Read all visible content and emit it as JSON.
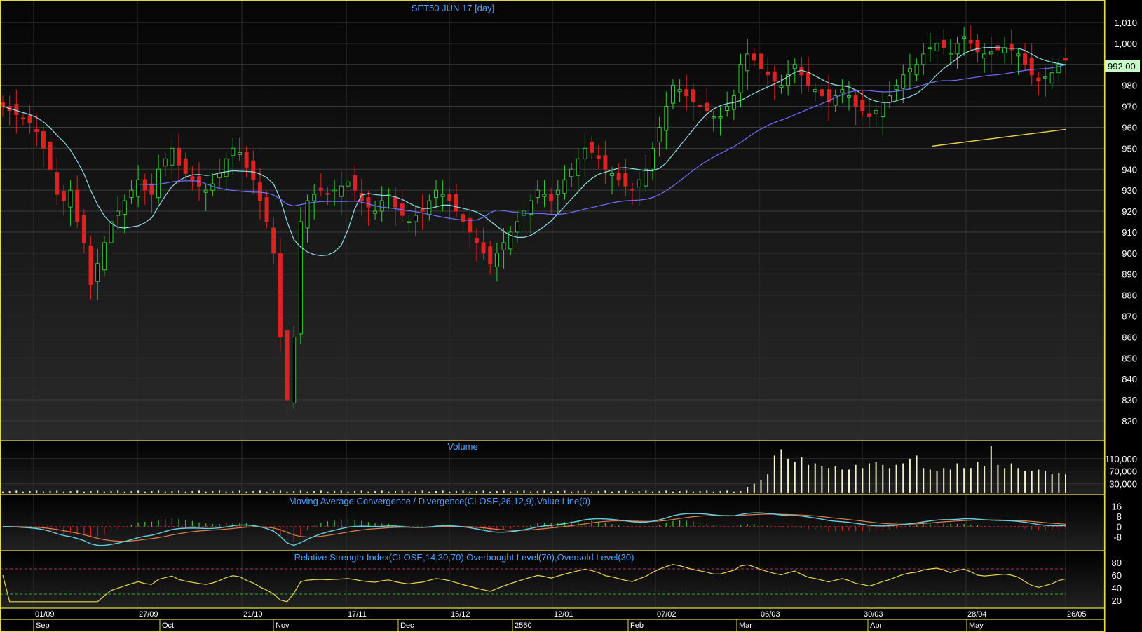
{
  "window": {
    "main_title": "SET50 JUN 17   [day]",
    "last_price_label": "992.00",
    "colors": {
      "background": "#000000",
      "border": "#e6d84a",
      "up": "#33cc33",
      "down": "#dd2222",
      "accent_text": "#4aa3ff"
    }
  },
  "chart_data": [
    {
      "type": "candlestick",
      "title": "SET50 JUN 17   [day]",
      "ylim": [
        810,
        1018
      ],
      "y_ticks": [
        "1,010",
        "1,000",
        "990",
        "980",
        "970",
        "960",
        "950",
        "940",
        "930",
        "920",
        "910",
        "900",
        "890",
        "880",
        "870",
        "860",
        "850",
        "840",
        "830",
        "820"
      ],
      "last_value": 992,
      "close_series_approx": [
        970,
        968,
        966,
        964,
        962,
        958,
        950,
        940,
        928,
        925,
        930,
        915,
        905,
        885,
        895,
        905,
        915,
        920,
        925,
        930,
        935,
        930,
        928,
        940,
        945,
        950,
        942,
        938,
        935,
        932,
        930,
        933,
        938,
        945,
        950,
        948,
        941,
        935,
        925,
        915,
        900,
        860,
        830,
        860,
        915,
        925,
        928,
        930,
        928,
        930,
        932,
        934,
        930,
        925,
        922,
        920,
        925,
        928,
        922,
        918,
        915,
        918,
        920,
        925,
        930,
        928,
        925,
        920,
        915,
        910,
        905,
        900,
        895,
        900,
        905,
        910,
        915,
        920,
        925,
        930,
        928,
        925,
        930,
        935,
        940,
        945,
        950,
        948,
        945,
        940,
        938,
        935,
        932,
        930,
        935,
        940,
        950,
        960,
        970,
        980,
        978,
        975,
        972,
        970,
        968,
        965,
        965,
        970,
        975,
        990,
        995,
        992,
        988,
        985,
        982,
        980,
        985,
        990,
        985,
        980,
        978,
        975,
        972,
        975,
        978,
        975,
        970,
        968,
        965,
        968,
        972,
        975,
        980,
        985,
        988,
        990,
        995,
        998,
        1000,
        998,
        995,
        1000,
        1003,
        1000,
        996,
        995,
        996,
        997,
        998,
        997,
        995,
        990,
        985,
        982,
        984,
        986,
        990,
        992
      ]
    },
    {
      "type": "bar",
      "title": "Volume",
      "y_ticks": [
        "110,000",
        "70,000",
        "30,000"
      ],
      "ylim": [
        0,
        150000
      ],
      "values_approx_recent": [
        20000,
        30000,
        40000,
        60000,
        120000,
        140000,
        110000,
        100000,
        115000,
        90000,
        95000,
        85000,
        80000,
        85000,
        75000,
        75000,
        90000,
        80000,
        95000,
        100000,
        90000,
        80000,
        90000,
        95000,
        110000,
        120000,
        80000,
        75000,
        70000,
        80000,
        75000,
        95000,
        80000,
        80000,
        100000,
        85000,
        150000,
        90000,
        80000,
        95000,
        80000,
        70000,
        70000,
        75000,
        70000,
        60000,
        65000,
        60000
      ]
    },
    {
      "type": "line",
      "title": "Moving Average Convergence / Divergence(CLOSE,26,12,9),Value Line(0)",
      "y_ticks": [
        "16",
        "8",
        "0",
        "-8"
      ],
      "ylim": [
        -16,
        20
      ]
    },
    {
      "type": "line",
      "title": "Relative Strength Index(CLOSE,14,30,70),Overbought Level(70),Oversold Level(30)",
      "y_ticks": [
        "80",
        "60",
        "40",
        "20"
      ],
      "ylim": [
        10,
        90
      ],
      "overbought": 70,
      "oversold": 30
    }
  ],
  "x_axis": {
    "dates": [
      "01/09",
      "27/09",
      "21/10",
      "17/11",
      "15/12",
      "12/01",
      "07/02",
      "06/03",
      "30/03",
      "28/04",
      "26/05"
    ],
    "months": [
      "Sep",
      "Oct",
      "Nov",
      "Dec",
      "2560",
      "Feb",
      "Mar",
      "Apr",
      "May"
    ]
  }
}
